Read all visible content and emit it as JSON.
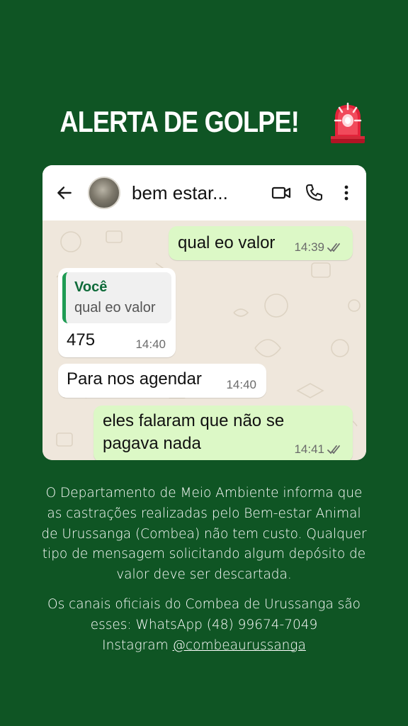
{
  "headline": {
    "text": "ALERTA DE GOLPE!",
    "icon": "siren-icon"
  },
  "chat_header": {
    "contact_name": "bem estar...",
    "icons": [
      "back-arrow-icon",
      "video-call-icon",
      "phone-call-icon",
      "more-options-icon"
    ]
  },
  "messages": [
    {
      "direction": "outgoing",
      "text": "qual eo valor",
      "time": "14:39",
      "status": "read"
    },
    {
      "direction": "incoming",
      "quote_author": "Você",
      "quote_text": "qual eo valor",
      "text": "475",
      "time": "14:40"
    },
    {
      "direction": "incoming",
      "text": "Para nos agendar",
      "time": "14:40"
    },
    {
      "direction": "outgoing",
      "text_line1": "eles falaram que não se",
      "text_line2": "pagava nada",
      "time": "14:41",
      "status": "read"
    }
  ],
  "notice": {
    "lines": [
      "O Departamento de Meio Ambiente informa que",
      "as castrações realizadas pelo Bem-estar Animal",
      "de Urussanga (Combea) não tem custo. Qualquer",
      "tipo de mensagem solicitando algum depósito de",
      "valor deve ser descartada."
    ]
  },
  "contacts": {
    "line1": "Os canais oficiais do Combea de Urussanga são",
    "line2": "esses:  WhatsApp (48) 99674-7049",
    "instagram_prefix": "Instagram ",
    "instagram_handle": "@combeaurussanga"
  },
  "colors": {
    "background": "#0f5524",
    "outgoing_bubble": "#dcf8c6",
    "incoming_bubble": "#ffffff",
    "quote_bar": "#1f9c54",
    "read_ticks": "#6b6b6b"
  }
}
